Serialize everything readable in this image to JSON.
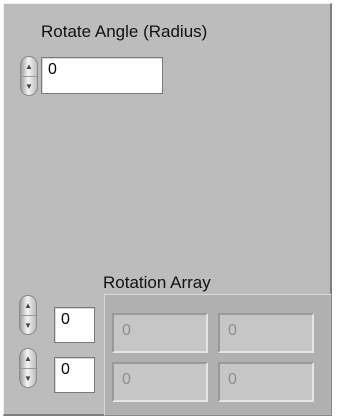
{
  "rotate_angle": {
    "label": "Rotate Angle (Radius)",
    "value": "0"
  },
  "rotation_array": {
    "label": "Rotation Array",
    "index_values": [
      "0",
      "0"
    ],
    "rows": [
      [
        "0",
        "0"
      ],
      [
        "0",
        "0"
      ]
    ]
  }
}
